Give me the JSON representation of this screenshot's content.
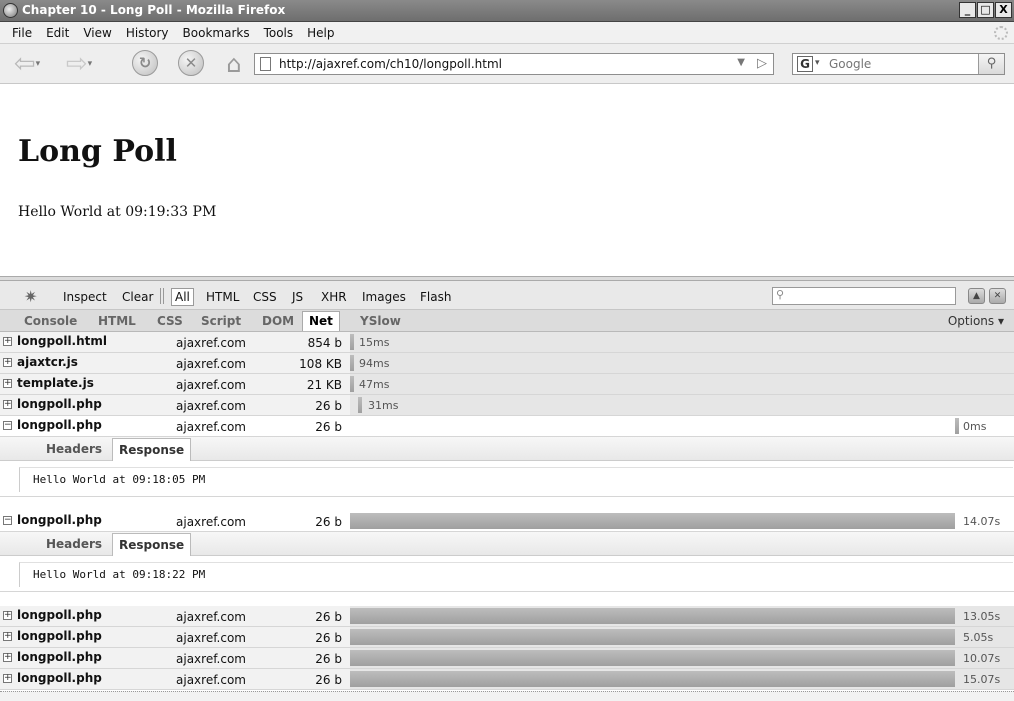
{
  "window": {
    "title": "Chapter 10 - Long Poll - Mozilla Firefox",
    "minimize": "_",
    "maximize": "□",
    "close": "X"
  },
  "menubar": {
    "items": [
      "File",
      "Edit",
      "View",
      "History",
      "Bookmarks",
      "Tools",
      "Help"
    ]
  },
  "navbar": {
    "url": "http://ajaxref.com/ch10/longpoll.html",
    "search_placeholder": "Google",
    "search_engine": "G"
  },
  "page": {
    "heading": "Long Poll",
    "message": "Hello World at 09:19:33 PM"
  },
  "firebug": {
    "toolbar": {
      "inspect": "Inspect",
      "clear": "Clear",
      "filters": [
        "All",
        "HTML",
        "CSS",
        "JS",
        "XHR",
        "Images",
        "Flash"
      ]
    },
    "panels": [
      "Console",
      "HTML",
      "CSS",
      "Script",
      "DOM",
      "Net",
      "YSlow"
    ],
    "active_panel": "Net",
    "options": "Options ▾"
  },
  "net": {
    "rows": [
      {
        "file": "longpoll.html",
        "host": "ajaxref.com",
        "size": "854 b",
        "time": "15ms",
        "expanded": false
      },
      {
        "file": "ajaxtcr.js",
        "host": "ajaxref.com",
        "size": "108 KB",
        "time": "94ms",
        "expanded": false
      },
      {
        "file": "template.js",
        "host": "ajaxref.com",
        "size": "21 KB",
        "time": "47ms",
        "expanded": false
      },
      {
        "file": "longpoll.php",
        "host": "ajaxref.com",
        "size": "26 b",
        "time": "31ms",
        "expanded": false
      },
      {
        "file": "longpoll.php",
        "host": "ajaxref.com",
        "size": "26 b",
        "time": "0ms",
        "expanded": true
      },
      {
        "file": "longpoll.php",
        "host": "ajaxref.com",
        "size": "26 b",
        "time": "14.07s",
        "expanded": true
      },
      {
        "file": "longpoll.php",
        "host": "ajaxref.com",
        "size": "26 b",
        "time": "13.05s",
        "expanded": false
      },
      {
        "file": "longpoll.php",
        "host": "ajaxref.com",
        "size": "26 b",
        "time": "5.05s",
        "expanded": false
      },
      {
        "file": "longpoll.php",
        "host": "ajaxref.com",
        "size": "26 b",
        "time": "10.07s",
        "expanded": false
      },
      {
        "file": "longpoll.php",
        "host": "ajaxref.com",
        "size": "26 b",
        "time": "15.07s",
        "expanded": false
      }
    ],
    "details": [
      {
        "tabs": [
          "Headers",
          "Response"
        ],
        "active_tab": "Response",
        "response": "Hello World at 09:18:05 PM"
      },
      {
        "tabs": [
          "Headers",
          "Response"
        ],
        "active_tab": "Response",
        "response": "Hello World at 09:18:22 PM"
      }
    ]
  },
  "colors": {
    "titlebar": "#7a7a7a",
    "bar": "#aaaaaa",
    "row_bg": "#f2f2f2"
  },
  "icons": [
    "firefox-logo-icon",
    "back-arrow-icon",
    "forward-arrow-icon",
    "reload-icon",
    "stop-icon",
    "home-icon",
    "page-icon",
    "go-arrow-icon",
    "search-magnifier-icon",
    "firebug-icon",
    "expand-icon",
    "collapse-icon"
  ]
}
